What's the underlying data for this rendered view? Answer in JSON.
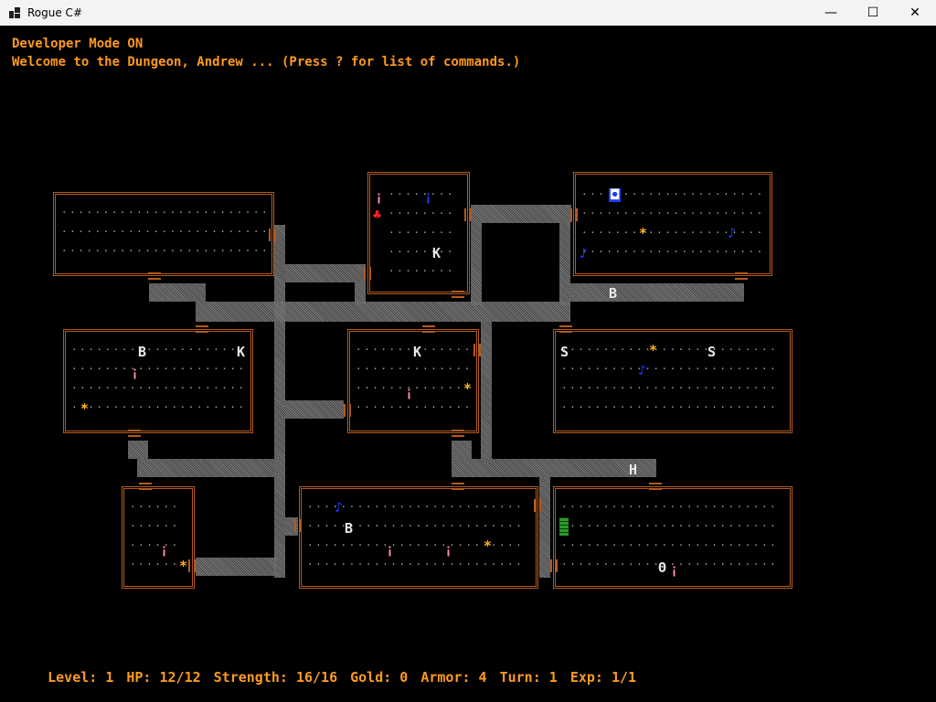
{
  "window": {
    "title": "Rogue C#",
    "buttons": {
      "minimize": "—",
      "maximize": "☐",
      "close": "✕"
    }
  },
  "messages": {
    "line1": "Developer Mode ON",
    "line2": "Welcome to the Dungeon, Andrew ... (Press ? for list of commands.)"
  },
  "status": {
    "level": "Level: 1",
    "hp": "HP: 12/12",
    "strength": "Strength: 16/16",
    "gold": "Gold: 0",
    "armor": "Armor: 4",
    "turn": "Turn: 1",
    "exp": "Exp: 1/1"
  },
  "glyphs": {
    "monster_B": "B",
    "monster_K": "K",
    "monster_S": "S",
    "monster_H": "H",
    "potion": "¡",
    "gold": "*",
    "scroll": "♪",
    "food": "♣",
    "player": "Θ",
    "amulet": "◘"
  },
  "colors": {
    "message": "#ff9a1f",
    "wall": "#b35a1e",
    "floor": "#a8a8a8",
    "passage": "#8a8a8a",
    "stairs": "#2a9a2a"
  }
}
